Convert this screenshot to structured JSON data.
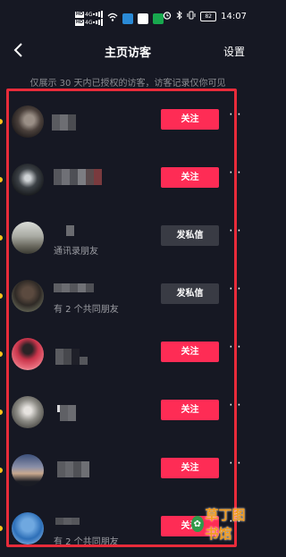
{
  "status": {
    "sim1": "HD",
    "sim2": "HD",
    "signal1": "4G",
    "signal2": "4G",
    "battery": "82",
    "time": "14:07"
  },
  "nav": {
    "back_icon": "chevron-left-icon",
    "title": "主页访客",
    "settings": "设置"
  },
  "notice": "仅展示 30 天内已授权的访客，访客记录仅你可见",
  "visitors": [
    {
      "subtitle": "",
      "action": "关注",
      "style": "red"
    },
    {
      "subtitle": "",
      "action": "关注",
      "style": "red"
    },
    {
      "subtitle": "通讯录朋友",
      "action": "发私信",
      "style": "gray"
    },
    {
      "subtitle": "有 2 个共同朋友",
      "action": "发私信",
      "style": "gray"
    },
    {
      "subtitle": "",
      "action": "关注",
      "style": "red"
    },
    {
      "subtitle": "",
      "action": "关注",
      "style": "red"
    },
    {
      "subtitle": "",
      "action": "关注",
      "style": "red"
    },
    {
      "subtitle": "有 2 个共同朋友",
      "action": "关注",
      "style": "red"
    }
  ],
  "colors": {
    "background": "#161823",
    "follow_button": "#fe2c55",
    "message_button": "#393b44",
    "highlight_border": "#e82b3a",
    "unread_dot": "#f7c21b"
  },
  "watermark": "草丁图书馆"
}
